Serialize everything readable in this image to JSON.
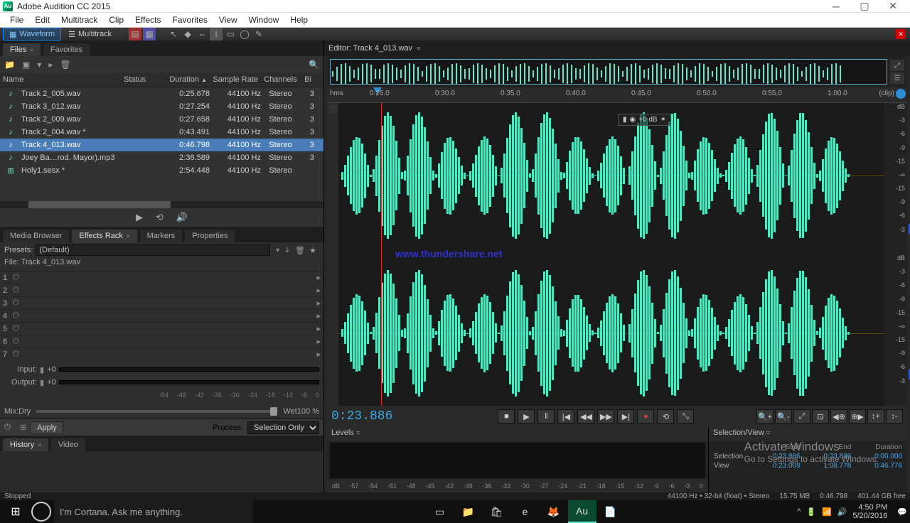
{
  "app": {
    "title": "Adobe Audition CC 2015"
  },
  "menu": [
    "File",
    "Edit",
    "Multitrack",
    "Clip",
    "Effects",
    "Favorites",
    "View",
    "Window",
    "Help"
  ],
  "modes": {
    "waveform": "Waveform",
    "multitrack": "Multitrack"
  },
  "panels": {
    "files_tab": "Files",
    "favorites_tab": "Favorites",
    "media_browser": "Media Browser",
    "effects_rack": "Effects Rack",
    "markers": "Markers",
    "properties": "Properties",
    "history": "History",
    "video": "Video"
  },
  "files": {
    "columns": {
      "name": "Name",
      "status": "Status",
      "duration": "Duration",
      "sample_rate": "Sample Rate",
      "channels": "Channels",
      "bit": "Bi"
    },
    "rows": [
      {
        "name": "Track 2_005.wav",
        "duration": "0:25.678",
        "sr": "44100 Hz",
        "ch": "Stereo",
        "bit": "3"
      },
      {
        "name": "Track 3_012.wav",
        "duration": "0:27.254",
        "sr": "44100 Hz",
        "ch": "Stereo",
        "bit": "3"
      },
      {
        "name": "Track 2_009.wav",
        "duration": "0:27.658",
        "sr": "44100 Hz",
        "ch": "Stereo",
        "bit": "3"
      },
      {
        "name": "Track 2_004.wav *",
        "duration": "0:43.491",
        "sr": "44100 Hz",
        "ch": "Stereo",
        "bit": "3"
      },
      {
        "name": "Track 4_013.wav",
        "duration": "0:46.798",
        "sr": "44100 Hz",
        "ch": "Stereo",
        "bit": "3",
        "selected": true
      },
      {
        "name": "Joey Ba…rod. Mayor).mp3",
        "duration": "2:38.589",
        "sr": "44100 Hz",
        "ch": "Stereo",
        "bit": "3"
      },
      {
        "name": "Holy1.sesx *",
        "duration": "2:54.448",
        "sr": "44100 Hz",
        "ch": "Stereo",
        "bit": ""
      }
    ]
  },
  "effects": {
    "presets_label": "Presets:",
    "presets_value": "(Default)",
    "file_label": "File: Track 4_013.wav",
    "slots": [
      "1",
      "2",
      "3",
      "4",
      "5",
      "6",
      "7"
    ],
    "input": "Input:",
    "output": "Output:",
    "gain": "+0",
    "mix_dry": "Mix:",
    "dry": "Dry",
    "wet": "Wet",
    "wet_pct": "100 %",
    "apply": "Apply",
    "process": "Process:",
    "process_val": "Selection Only"
  },
  "editor": {
    "header": "Editor: Track 4_013.wav",
    "hms": "hms",
    "ticks": [
      "0:25.0",
      "0:30.0",
      "0:35.0",
      "0:40.0",
      "0:45.0",
      "0:50.0",
      "0:55.0",
      "1:00.0"
    ],
    "clip": "(clip)",
    "hud_db": "+0 dB",
    "watermark": "www.thundershare.net",
    "timecode": "0:23.886",
    "db_labels": [
      "dB",
      "-3",
      "-6",
      "-9",
      "-15",
      "-∞",
      "-15",
      "-9",
      "-6",
      "-3"
    ]
  },
  "levels": {
    "title": "Levels",
    "ruler": [
      "dB",
      "-57",
      "-54",
      "-51",
      "-48",
      "-45",
      "-42",
      "-39",
      "-36",
      "-33",
      "-30",
      "-27",
      "-24",
      "-21",
      "-18",
      "-15",
      "-12",
      "-9",
      "-6",
      "-3",
      "0"
    ]
  },
  "selview": {
    "title": "Selection/View",
    "cols": [
      "Start",
      "End",
      "Duration"
    ],
    "rows": [
      {
        "label": "Selection",
        "start": "0:23.886",
        "end": "0:23.886",
        "dur": "0:00.000"
      },
      {
        "label": "View",
        "start": "0:23.009",
        "end": "1:08.778",
        "dur": "0:46.776"
      }
    ]
  },
  "activate": {
    "t1": "Activate Windows",
    "t2": "Go to Settings to activate Windows."
  },
  "status": {
    "state": "Stopped",
    "format": "44100 Hz • 32-bit (float) • Stereo",
    "size": "15.75 MB",
    "dur": "0:46.798",
    "free": "401.44 GB free"
  },
  "taskbar": {
    "cortana": "I'm Cortana. Ask me anything.",
    "time": "4:50 PM",
    "date": "5/20/2016"
  }
}
